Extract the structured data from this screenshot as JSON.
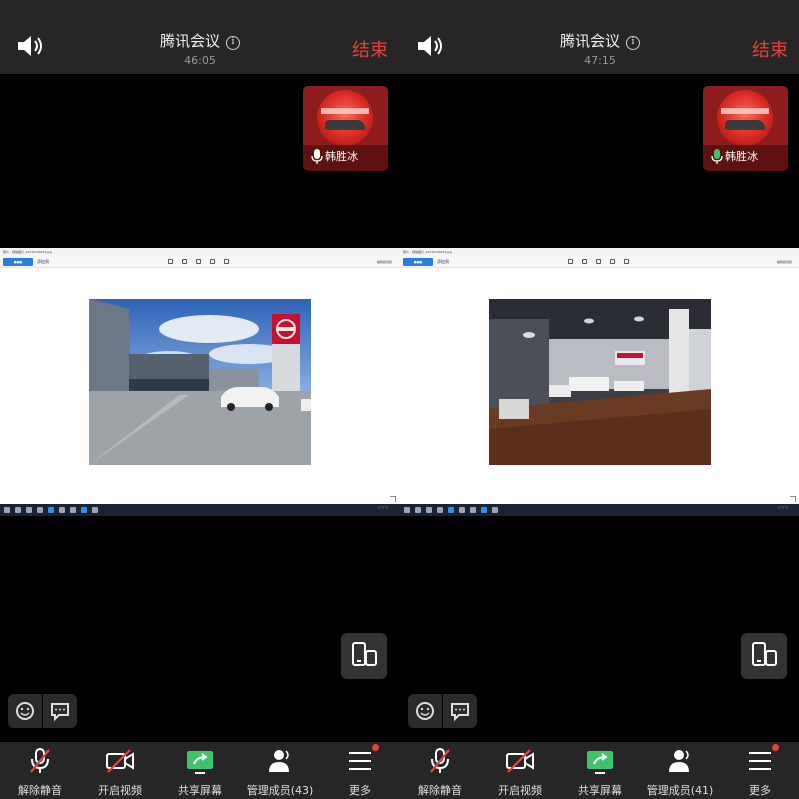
{
  "panes": [
    {
      "header": {
        "title": "腾讯会议",
        "timer": "46:05",
        "end_label": "结束"
      },
      "participant": {
        "name": "韩胜冰"
      },
      "share": {
        "window_title": "照片 - 微信图片_20210108150.jpg",
        "edit_label": "编辑和创建",
        "add_label": "添加到",
        "photo": "storefront"
      },
      "toolbar": [
        {
          "label": "解除静音",
          "icon": "mic-muted-icon"
        },
        {
          "label": "开启视频",
          "icon": "camera-off-icon"
        },
        {
          "label": "共享屏幕",
          "icon": "share-screen-icon"
        },
        {
          "label": "管理成员(43)",
          "icon": "members-icon"
        },
        {
          "label": "更多",
          "icon": "more-menu-icon"
        }
      ]
    },
    {
      "header": {
        "title": "腾讯会议",
        "timer": "47:15",
        "end_label": "结束"
      },
      "participant": {
        "name": "韩胜冰"
      },
      "share": {
        "window_title": "照片 - 微信图片_20210108150.jpg",
        "edit_label": "编辑和创建",
        "add_label": "添加到",
        "photo": "showroom"
      },
      "toolbar": [
        {
          "label": "解除静音",
          "icon": "mic-muted-icon"
        },
        {
          "label": "开启视频",
          "icon": "camera-off-icon"
        },
        {
          "label": "共享屏幕",
          "icon": "share-screen-icon"
        },
        {
          "label": "管理成员(41)",
          "icon": "members-icon"
        },
        {
          "label": "更多",
          "icon": "more-menu-icon"
        }
      ]
    }
  ],
  "colors": {
    "end_red": "#e8433a",
    "bar_bg": "#262626",
    "share_green": "#3ec46d",
    "mic_green": "#3ec46d"
  }
}
